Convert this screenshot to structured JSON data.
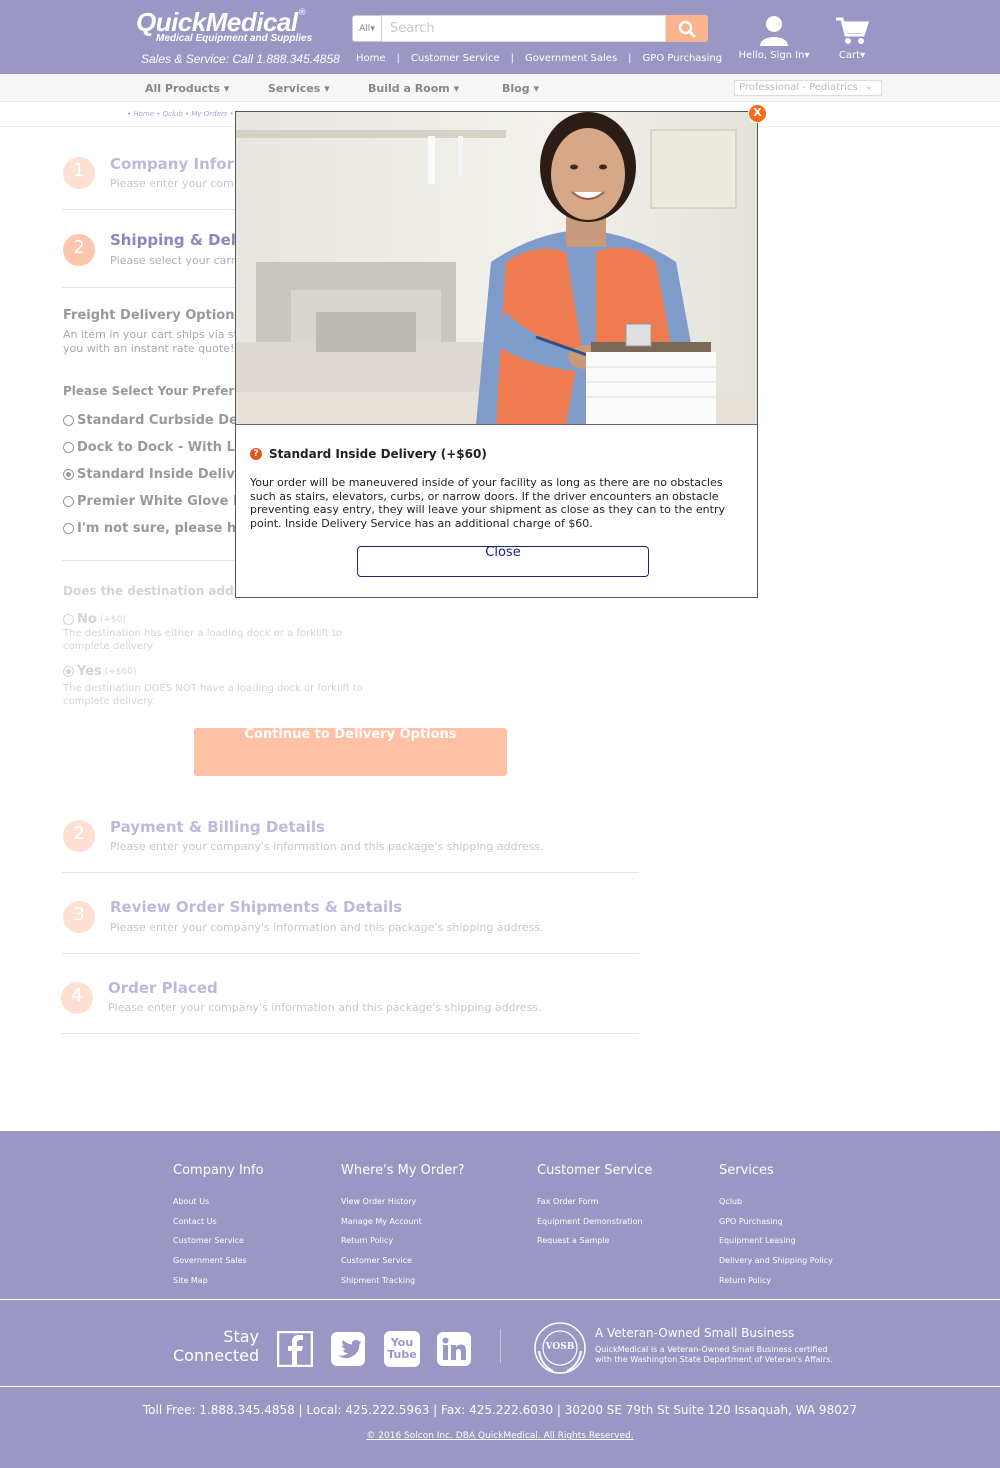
{
  "header": {
    "brand": "QuickMedical",
    "brand_mark": "®",
    "tagline": "Medical Equipment and Supplies",
    "sales_line": "Sales & Service: Call 1.888.345.4858",
    "search_category": "All",
    "search_placeholder": "Search",
    "top_links": [
      "Home",
      "Customer Service",
      "Government Sales",
      "GPO Purchasing"
    ],
    "account_label": "Hello, Sign In",
    "cart_label": "Cart"
  },
  "category_nav": {
    "items": [
      "All Products",
      "Services",
      "Build a Room",
      "Blog"
    ],
    "profession_select": "Professional - Pediatrics"
  },
  "breadcrumb": "• Home • Qclub • My Orders • O",
  "steps": {
    "company": {
      "number": "1",
      "title": "Company Informa",
      "subtitle": "Please enter your com"
    },
    "shipping": {
      "number": "2",
      "title": "Shipping & Delive",
      "subtitle": "Please select your carri"
    },
    "payment": {
      "number": "2",
      "title": "Payment & Billing Details",
      "subtitle": "Please enter your company's information and this package's shipping address."
    },
    "review": {
      "number": "3",
      "title": "Review Order Shipments & Details",
      "subtitle": "Please enter your company's information and this package's shipping address."
    },
    "placed": {
      "number": "4",
      "title": "Order Placed",
      "subtitle": "Please enter your company's information and this package's shipping address."
    }
  },
  "freight": {
    "title": "Freight Delivery Options",
    "desc_1": "An item in your cart ships via st",
    "desc_2": "you with an instant rate quote!",
    "prompt": "Please Select Your Preferred F",
    "options": [
      {
        "label": "Standard Curbside Delive",
        "selected": false
      },
      {
        "label": "Dock to Dock - With Liftga",
        "selected": false
      },
      {
        "label": "Standard Inside Delivery (",
        "selected": true
      },
      {
        "label": "Premier White Glove Deliv",
        "selected": false
      },
      {
        "label": "I'm not sure, please have",
        "selected": false
      }
    ]
  },
  "destination": {
    "question": "Does the destination address",
    "no_label": "No",
    "no_price": "(+$0)",
    "no_desc": "The destination has either a loading dock or a forklift to complete delivery",
    "yes_label": "Yes",
    "yes_price": "(+$60)",
    "yes_desc": "The destination DOES NOT have a loading dock or forklift to complete delivery.",
    "continue_label": "Continue to Delivery Options"
  },
  "modal": {
    "close_x": "X",
    "help_icon_glyph": "?",
    "title": "Standard Inside Delivery (+$60)",
    "body": "Your order will be maneuvered inside of your facility as long as there are no obstacles such as stairs, elevators, curbs, or narrow doors. If the driver encounters an obstacle preventing easy entry, they will leave your shipment as close as they can to the entry point. Inside Delivery Service has an additional charge of $60.",
    "close_label": "Close"
  },
  "footer": {
    "columns": [
      {
        "title": "Company Info",
        "links": [
          "About Us",
          "Contact Us",
          "Customer Service",
          "Government Sales",
          "Site Map"
        ]
      },
      {
        "title": "Where's My Order?",
        "links": [
          "View Order History",
          "Manage My Account",
          "Return Policy",
          "Customer Service",
          "Shipment Tracking"
        ]
      },
      {
        "title": "Customer Service",
        "links": [
          "Fax Order Form",
          "Equipment Demonstration",
          "Request a Sample"
        ]
      },
      {
        "title": "Services",
        "links": [
          "Qclub",
          "GPO Purchasing",
          "Equipment Leasing",
          "Delivery and Shipping Policy",
          "Return Policy"
        ]
      }
    ],
    "stay_connected": "Stay Connected",
    "social": [
      "facebook-icon",
      "twitter-icon",
      "youtube-icon",
      "linkedin-icon"
    ],
    "youtube_you": "You",
    "youtube_tube": "Tube",
    "vosb_badge": "VOSB",
    "vosb_title": "A Veteran-Owned Small Business",
    "vosb_text": "QuickMedical is a Veteran-Owned Small Business certified with the Washington State Department of Veteran's Affairs.",
    "contact_line": "Toll Free: 1.888.345.4858  |  Local: 425.222.5963  |  Fax: 425.222.6030  |  30200 SE 79th St Suite 120 Issaquah, WA 98027",
    "copyright": "© 2016 Solcon Inc. DBA QuickMedical. All Rights Reserved."
  },
  "colors": {
    "header_bg": "#9b97c4",
    "accent_orange": "#fcb48e",
    "close_red": "#ff6a1a",
    "modal_button_border": "#1a237e"
  }
}
